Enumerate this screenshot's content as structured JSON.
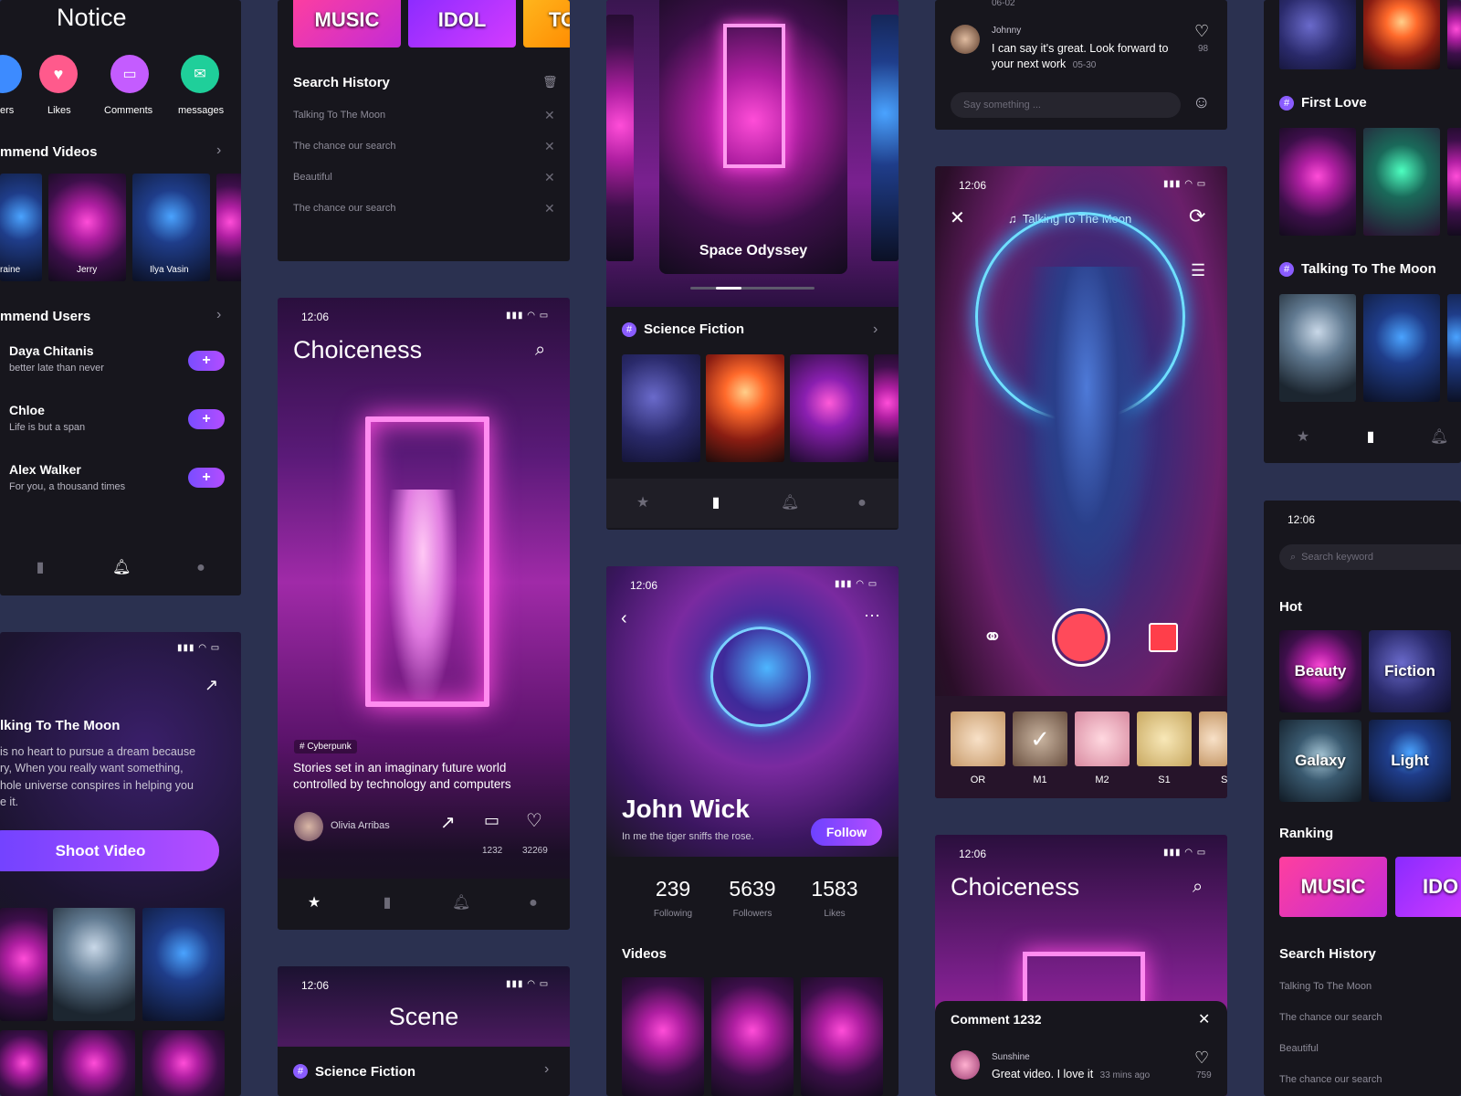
{
  "notice_panel": {
    "title": "Notice",
    "icons": [
      {
        "label": "ers",
        "icon": "followers-icon",
        "color": "#3d8bff"
      },
      {
        "label": "Likes",
        "icon": "heart-icon",
        "color": "#ff5a8c"
      },
      {
        "label": "Comments",
        "icon": "comment-icon",
        "color": "#c45cff"
      },
      {
        "label": "messages",
        "icon": "mail-icon",
        "color": "#1fcf9a"
      }
    ],
    "recommend_videos_title": "mmend Videos",
    "videos": [
      {
        "name": "raine"
      },
      {
        "name": "Jerry"
      },
      {
        "name": "Ilya Vasin"
      }
    ],
    "recommend_users_title": "mmend Users",
    "users": [
      {
        "name": "Daya Chitanis",
        "bio": "better late than never"
      },
      {
        "name": "Chloe",
        "bio": "Life is but a span"
      },
      {
        "name": "Alex Walker",
        "bio": "For you, a thousand times"
      }
    ],
    "follow_symbol": "+"
  },
  "moon_panel": {
    "title": "lking To The Moon",
    "text": [
      "is no heart to pursue a dream because",
      "ry, When you really want something,",
      "hole universe conspires in helping you",
      "e it."
    ],
    "button": "Shoot Video"
  },
  "search_panel": {
    "tabs": [
      "MUSIC",
      "IDOL",
      "TO"
    ],
    "title": "Search History",
    "items": [
      "Talking To The Moon",
      "The chance our search",
      "Beautiful",
      "The chance our search"
    ]
  },
  "choiceness_panel": {
    "time": "12:06",
    "title": "Choiceness",
    "tag": "# Cyberpunk",
    "caption": "Stories set in an imaginary future world controlled by technology and computers",
    "author": "Olivia Arribas",
    "comments": "1232",
    "likes": "32269"
  },
  "scene_panel": {
    "time": "12:06",
    "title": "Scene",
    "section": "Science Fiction"
  },
  "odyssey_panel": {
    "hero_title": "Space Odyssey",
    "section": "Science Fiction"
  },
  "profile_panel": {
    "time": "12:06",
    "name": "John Wick",
    "bio": "In me the tiger sniffs the rose.",
    "follow": "Follow",
    "stats": [
      {
        "value": "239",
        "label": "Following"
      },
      {
        "value": "5639",
        "label": "Followers"
      },
      {
        "value": "1583",
        "label": "Likes"
      }
    ],
    "videos_title": "Videos"
  },
  "comment_top_panel": {
    "date": "06-02",
    "user": "Johnny",
    "text": "I can say it's great. Look forward to your next work",
    "time": "05-30",
    "likes": "98",
    "placeholder": "Say something ..."
  },
  "camera_panel": {
    "time": "12:06",
    "song": "Talking To The Moon",
    "filters": [
      "OR",
      "M1",
      "M2",
      "S1",
      "S"
    ]
  },
  "choiceness2_panel": {
    "time": "12:06",
    "title": "Choiceness",
    "comment_title": "Comment 1232",
    "user": "Sunshine",
    "text": "Great video. I love it",
    "ago": "33 mins ago",
    "likes": "759"
  },
  "right_panel": {
    "sections": [
      "First Love",
      "Talking To The Moon"
    ]
  },
  "right_search_panel": {
    "time": "12:06",
    "placeholder": "Search keyword",
    "hot_title": "Hot",
    "hot": [
      "Beauty",
      "Fiction",
      "Galaxy",
      "Light"
    ],
    "ranking_title": "Ranking",
    "ranking": [
      "MUSIC",
      "IDO"
    ],
    "history_title": "Search History",
    "history": [
      "Talking To The Moon",
      "The chance our search",
      "Beautiful",
      "The chance our search"
    ]
  },
  "colors": {
    "accent": "#8a5cff",
    "background": "#2b3150",
    "panel": "#17161d"
  }
}
